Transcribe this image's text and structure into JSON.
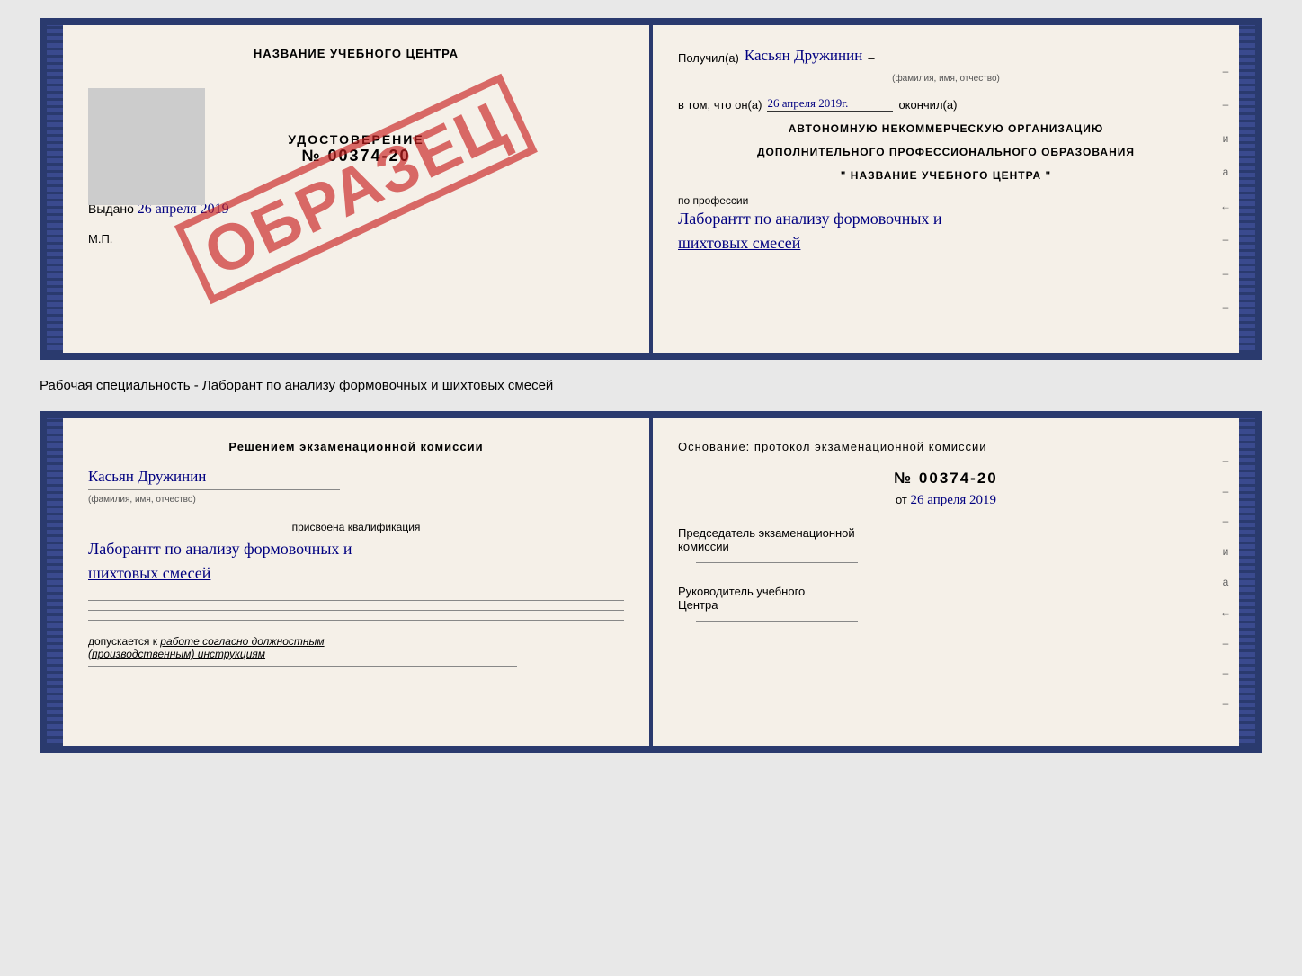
{
  "topDoc": {
    "left": {
      "title": "НАЗВАНИЕ УЧЕБНОГО ЦЕНТРА",
      "grayBox": true,
      "certLabel": "УДОСТОВЕРЕНИЕ",
      "certNumber": "№ 00374-20",
      "issueLabel": "Выдано",
      "issueDate": "26 апреля 2019",
      "mpLabel": "М.П.",
      "stampText": "ОБРАЗЕЦ"
    },
    "right": {
      "receivedLabel": "Получил(а)",
      "receivedName": "Касьян Дружинин",
      "nameSubtitle": "(фамилия, имя, отчество)",
      "inThatLabel": "в том, что он(а)",
      "completedDate": "26 апреля 2019г.",
      "completedLabel": "окончил(а)",
      "orgLine1": "АВТОНОМНУЮ НЕКОММЕРЧЕСКУЮ ОРГАНИЗАЦИЮ",
      "orgLine2": "ДОПОЛНИТЕЛЬНОГО ПРОФЕССИОНАЛЬНОГО ОБРАЗОВАНИЯ",
      "orgName": "\"  НАЗВАНИЕ УЧЕБНОГО ЦЕНТРА  \"",
      "professionLabel": "по профессии",
      "professionText": "Лаборантт по анализу формовочных и",
      "professionText2": "шихтовых смесей",
      "rightMarks": [
        "–",
        "–",
        "и",
        "а",
        "←",
        "–",
        "–",
        "–"
      ]
    }
  },
  "middleLabel": "Рабочая специальность - Лаборант по анализу формовочных и шихтовых смесей",
  "bottomDoc": {
    "left": {
      "title": "Решением  экзаменационной  комиссии",
      "name": "Касьян  Дружинин",
      "nameSubtitle": "(фамилия, имя, отчество)",
      "qualLabel": "присвоена квалификация",
      "qualText": "Лаборантт по анализу формовочных и",
      "qualText2": "шихтовых смесей",
      "dopuskLabel": "допускается к",
      "dopuskText": "работе согласно должностным",
      "dopuskText2": "(производственным) инструкциям"
    },
    "right": {
      "basisTitle": "Основание: протокол экзаменационной  комиссии",
      "protocolNumber": "№  00374-20",
      "fromLabel": "от",
      "fromDate": "26 апреля 2019",
      "chairTitle": "Председатель экзаменационной",
      "chairTitle2": "комиссии",
      "headTitle": "Руководитель учебного",
      "headTitle2": "Центра",
      "rightMarks": [
        "–",
        "–",
        "–",
        "и",
        "а",
        "←",
        "–",
        "–",
        "–"
      ]
    }
  }
}
